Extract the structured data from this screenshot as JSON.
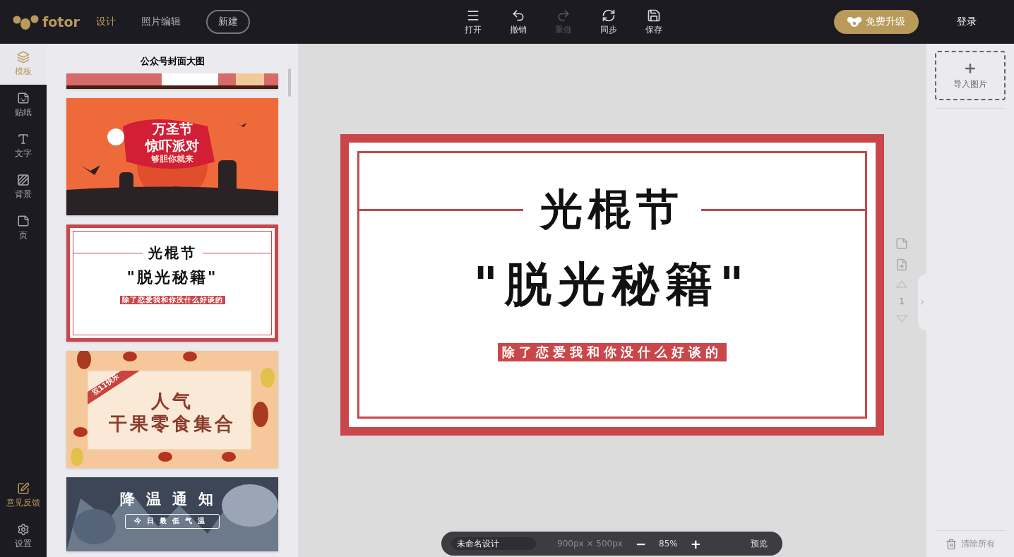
{
  "header": {
    "logo": "fotor",
    "nav": [
      {
        "label": "设计",
        "selected": true
      },
      {
        "label": "照片编辑",
        "selected": false
      }
    ],
    "new_button": "新建",
    "tools": [
      {
        "kind": "open",
        "label": "打开",
        "disabled": false
      },
      {
        "kind": "undo",
        "label": "撤销",
        "disabled": false
      },
      {
        "kind": "redo",
        "label": "重做",
        "disabled": true
      },
      {
        "kind": "sync",
        "label": "同步",
        "disabled": false
      },
      {
        "kind": "save",
        "label": "保存",
        "disabled": false
      }
    ],
    "upgrade_button": "免费升级",
    "login": "登录"
  },
  "sidebar": {
    "items": [
      {
        "kind": "templates",
        "label": "模板",
        "selected": true
      },
      {
        "kind": "stickers",
        "label": "贴纸",
        "selected": false
      },
      {
        "kind": "text",
        "label": "文字",
        "selected": false
      },
      {
        "kind": "background",
        "label": "背景",
        "selected": false
      },
      {
        "kind": "page",
        "label": "页",
        "selected": false
      }
    ],
    "bottom_items": [
      {
        "kind": "feedback",
        "label": "意见反馈"
      },
      {
        "kind": "settings",
        "label": "设置"
      }
    ]
  },
  "template_panel": {
    "title": "公众号封面大图",
    "templates": [
      {
        "kind": "picture"
      },
      {
        "kind": "halloween",
        "lines": [
          "万圣节",
          "惊吓派对",
          "够胆你就来"
        ]
      },
      {
        "kind": "singles",
        "lines": [
          "光棍节",
          "\"脱光秘籍\"",
          "除了恋爱我和你没什么好谈的"
        ]
      },
      {
        "kind": "autumn",
        "lines": [
          "双11快乐",
          "人气",
          "干果零食集合"
        ]
      },
      {
        "kind": "winter",
        "lines": [
          "降温通知",
          "今日最低气温"
        ]
      }
    ]
  },
  "design": {
    "title": "光棍节",
    "subtitle": "\"脱光秘籍\"",
    "tagline": "除了恋爱我和你没什么好谈的"
  },
  "page_tools": {
    "page_number": "1"
  },
  "right_panel": {
    "import_button": "导入图片",
    "clear_button": "清除所有",
    "clear_disabled": true
  },
  "bottom_bar": {
    "design_name": "未命名设计",
    "size": "900px × 500px",
    "zoom_out": "−",
    "zoom": "85%",
    "zoom_in": "+",
    "preview": "预览"
  }
}
